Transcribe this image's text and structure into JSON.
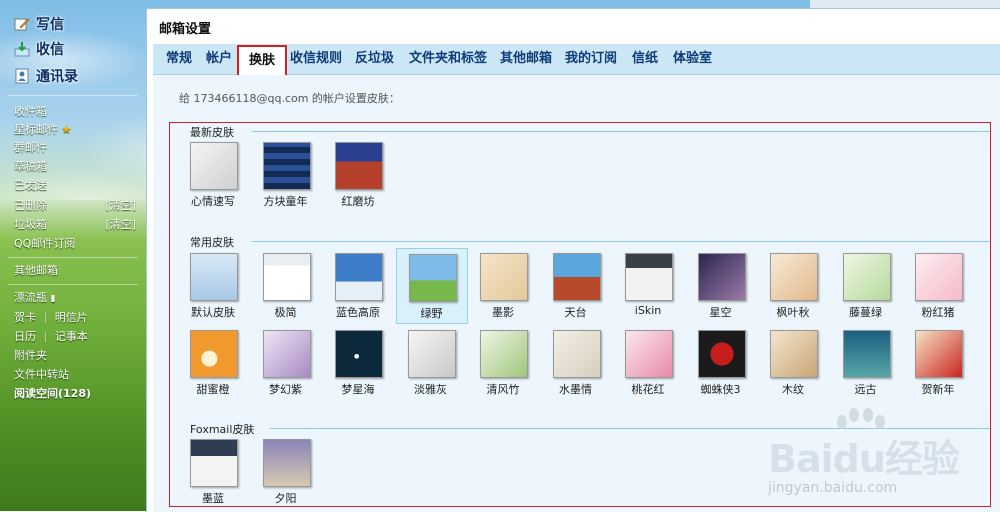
{
  "sidebar": {
    "write": "写信",
    "inbox": "收信",
    "contacts": "通讯录",
    "folders": [
      "收件箱",
      "星标邮件",
      "群邮件",
      "草稿箱",
      "已发送",
      "已删除",
      "垃圾箱",
      "QQ邮件订阅"
    ],
    "clear_label": "[清空]",
    "other": "其他邮箱",
    "drift": "漂流瓶",
    "card": "贺卡",
    "postcard": "明信片",
    "calendar": "日历",
    "notes": "记事本",
    "attachments": "附件夹",
    "transfer": "文件中转站",
    "reading": "阅读空间(128)"
  },
  "main": {
    "title": "邮箱设置",
    "tabs": [
      "常规",
      "帐户",
      "换肤",
      "收信规则",
      "反垃圾",
      "文件夹和标签",
      "其他邮箱",
      "我的订阅",
      "信纸",
      "体验室"
    ],
    "active_tab": "换肤",
    "info": "给 173466118@qq.com 的帐户设置皮肤：",
    "sections": {
      "newest_title": "最新皮肤",
      "newest": [
        "心情速写",
        "方块童年",
        "红磨坊"
      ],
      "common_title": "常用皮肤",
      "common_row1": [
        "默认皮肤",
        "极简",
        "蓝色高原",
        "绿野",
        "墨影",
        "天台",
        "iSkin",
        "星空",
        "枫叶秋",
        "藤蔓绿",
        "粉红猪"
      ],
      "common_row2": [
        "甜蜜橙",
        "梦幻紫",
        "梦星海",
        "淡雅灰",
        "清风竹",
        "水墨情",
        "桃花红",
        "蜘蛛侠3",
        "木纹",
        "远古",
        "贺新年"
      ],
      "foxmail_title": "Foxmail皮肤",
      "foxmail": [
        "墨蓝",
        "夕阳"
      ]
    },
    "selected_skin": "绿野"
  },
  "watermark": {
    "brand": "Baidu经验",
    "url": "jingyan.baidu.com"
  },
  "colors": {
    "tab_bar": "#cbe6f5",
    "active_border": "#d21f1f",
    "link_blue": "#0f3b7a",
    "content_bg": "#ecf6fc"
  }
}
